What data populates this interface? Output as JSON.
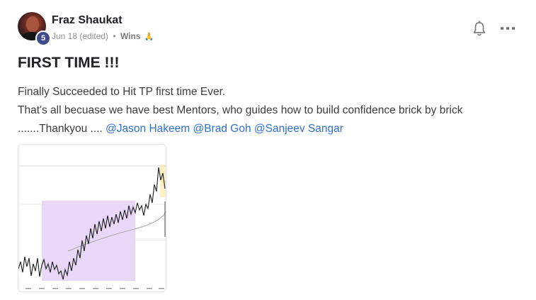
{
  "post": {
    "author": "Fraz Shaukat",
    "level": "5",
    "date": "Jun 18 (edited)",
    "separator": "•",
    "category": "Wins",
    "category_emoji": "🙏",
    "title": "FIRST TIME !!!",
    "line1": "Finally Succeeded to Hit TP first time Ever.",
    "line2": "That's all becuase we have best Mentors, who guides how to build confidence brick by brick",
    "line3_prefix": ".......Thankyou .... ",
    "mentions": [
      "@Jason Hakeem",
      "@Brad Goh",
      "@Sanjeev Sangar"
    ]
  },
  "icons": {
    "bell": "bell-icon",
    "more": "more-horizontal-icon"
  },
  "colors": {
    "mention": "#2e6fd8",
    "level_badge": "#3d4a8b",
    "chart_range_fill": "#e8d7f7",
    "chart_tp_fill": "#fbf1c4"
  },
  "attachment": {
    "type": "trading chart screenshot"
  }
}
